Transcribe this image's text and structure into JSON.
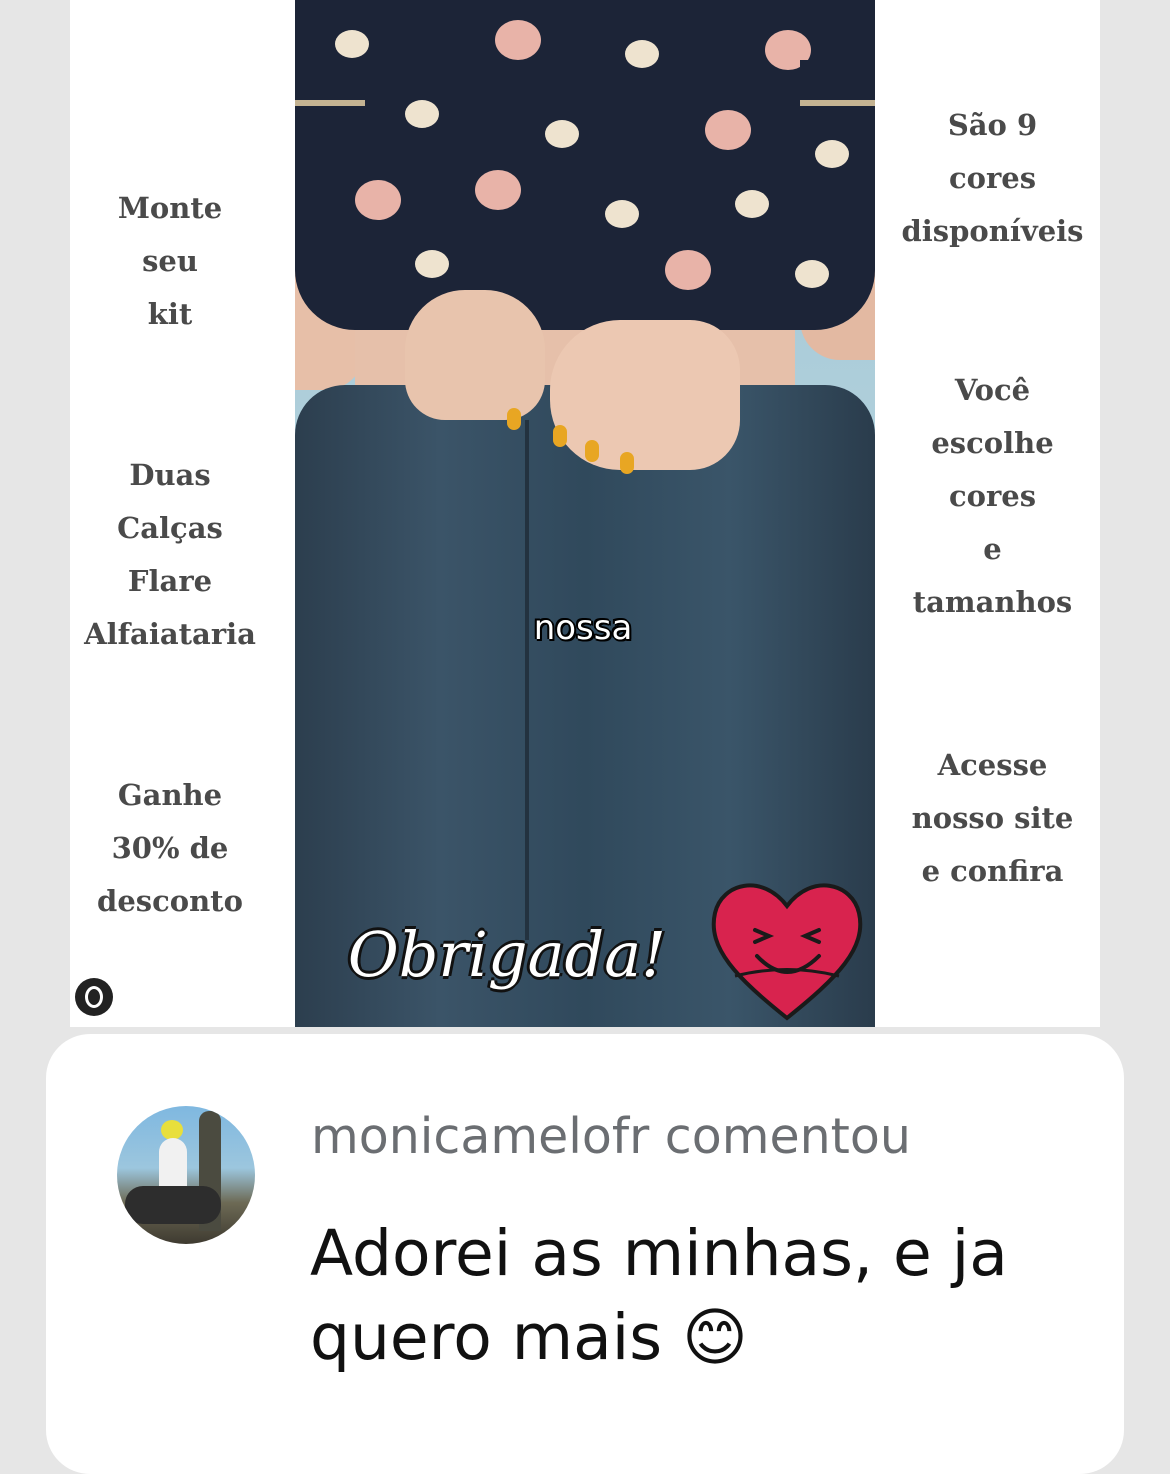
{
  "post": {
    "left_texts": [
      "Monte\nseu\nkit",
      "Duas\nCalças\nFlare\nAlfaiataria",
      "Ganhe\n30% de\ndesconto"
    ],
    "right_texts": [
      "São 9\ncores\ndisponíveis",
      "Você\nescolhe\ncores\ne\ntamanhos",
      "Acesse\nnosso site\ne confira"
    ],
    "video_caption": "nossa",
    "sticker_text": "Obrigada!"
  },
  "comment": {
    "username": "monicamelofr",
    "action": "comentou",
    "text": "Adorei as minhas, e ja quero mais 😊"
  },
  "colors": {
    "side_text": "#4a4a4a",
    "heart": "#d8234e",
    "background": "#e6e6e6"
  }
}
